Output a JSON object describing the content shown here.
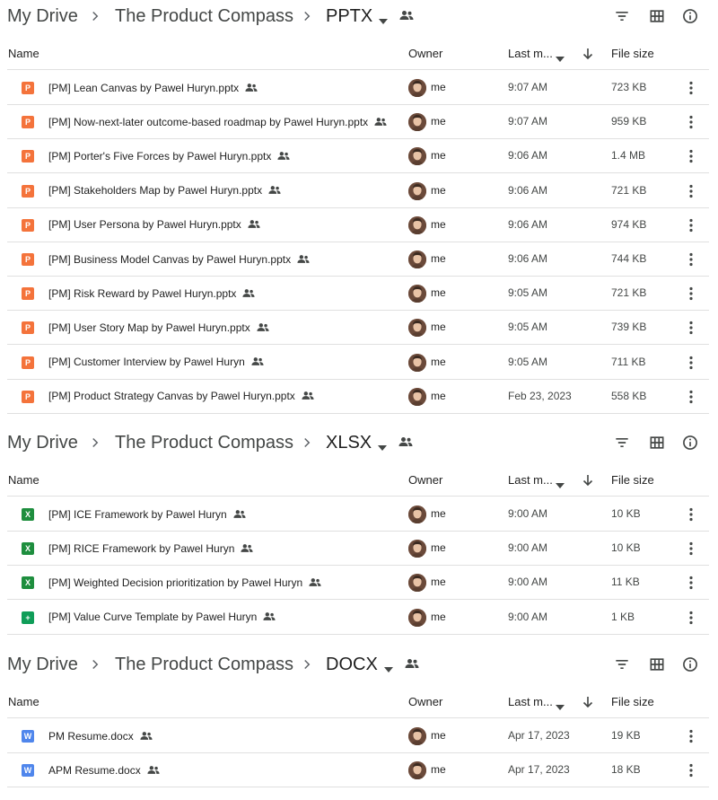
{
  "sections": [
    {
      "breadcrumb": [
        "My Drive",
        "The Product Compass",
        "PPTX"
      ],
      "headers": {
        "name": "Name",
        "owner": "Owner",
        "modified": "Last m...",
        "size": "File size"
      },
      "files": [
        {
          "type": "pptx",
          "badge": "P",
          "name": "[PM] Lean Canvas by Pawel Huryn.pptx",
          "owner": "me",
          "modified": "9:07 AM",
          "size": "723 KB"
        },
        {
          "type": "pptx",
          "badge": "P",
          "name": "[PM] Now-next-later outcome-based roadmap by Pawel Huryn.pptx",
          "owner": "me",
          "modified": "9:07 AM",
          "size": "959 KB"
        },
        {
          "type": "pptx",
          "badge": "P",
          "name": "[PM] Porter's Five Forces by Pawel Huryn.pptx",
          "owner": "me",
          "modified": "9:06 AM",
          "size": "1.4 MB"
        },
        {
          "type": "pptx",
          "badge": "P",
          "name": "[PM] Stakeholders Map by Pawel Huryn.pptx",
          "owner": "me",
          "modified": "9:06 AM",
          "size": "721 KB"
        },
        {
          "type": "pptx",
          "badge": "P",
          "name": "[PM] User Persona by Pawel Huryn.pptx",
          "owner": "me",
          "modified": "9:06 AM",
          "size": "974 KB"
        },
        {
          "type": "pptx",
          "badge": "P",
          "name": "[PM] Business Model Canvas by Pawel Huryn.pptx",
          "owner": "me",
          "modified": "9:06 AM",
          "size": "744 KB"
        },
        {
          "type": "pptx",
          "badge": "P",
          "name": "[PM] Risk Reward by Pawel Huryn.pptx",
          "owner": "me",
          "modified": "9:05 AM",
          "size": "721 KB"
        },
        {
          "type": "pptx",
          "badge": "P",
          "name": "[PM] User Story Map by Pawel Huryn.pptx",
          "owner": "me",
          "modified": "9:05 AM",
          "size": "739 KB"
        },
        {
          "type": "pptx",
          "badge": "P",
          "name": "[PM] Customer Interview by Pawel Huryn",
          "owner": "me",
          "modified": "9:05 AM",
          "size": "711 KB"
        },
        {
          "type": "pptx",
          "badge": "P",
          "name": "[PM] Product Strategy Canvas by Pawel Huryn.pptx",
          "owner": "me",
          "modified": "Feb 23, 2023",
          "size": "558 KB"
        }
      ]
    },
    {
      "breadcrumb": [
        "My Drive",
        "The Product Compass",
        "XLSX"
      ],
      "headers": {
        "name": "Name",
        "owner": "Owner",
        "modified": "Last m...",
        "size": "File size"
      },
      "files": [
        {
          "type": "xlsx",
          "badge": "X",
          "name": "[PM] ICE Framework by Pawel Huryn",
          "owner": "me",
          "modified": "9:00 AM",
          "size": "10 KB"
        },
        {
          "type": "xlsx",
          "badge": "X",
          "name": "[PM] RICE Framework by Pawel Huryn",
          "owner": "me",
          "modified": "9:00 AM",
          "size": "10 KB"
        },
        {
          "type": "xlsx",
          "badge": "X",
          "name": "[PM] Weighted Decision prioritization by Pawel Huryn",
          "owner": "me",
          "modified": "9:00 AM",
          "size": "11 KB"
        },
        {
          "type": "sheets",
          "badge": "+",
          "name": "[PM] Value Curve Template by Pawel Huryn",
          "owner": "me",
          "modified": "9:00 AM",
          "size": "1 KB"
        }
      ]
    },
    {
      "breadcrumb": [
        "My Drive",
        "The Product Compass",
        "DOCX"
      ],
      "headers": {
        "name": "Name",
        "owner": "Owner",
        "modified": "Last m...",
        "size": "File size"
      },
      "files": [
        {
          "type": "docx",
          "badge": "W",
          "name": "PM Resume.docx",
          "owner": "me",
          "modified": "Apr 17, 2023",
          "size": "19 KB"
        },
        {
          "type": "docx",
          "badge": "W",
          "name": "APM Resume.docx",
          "owner": "me",
          "modified": "Apr 17, 2023",
          "size": "18 KB"
        }
      ]
    }
  ],
  "icons": {
    "breadcrumb_separator": "chevron-right-icon",
    "folder_menu": "caret-down-icon",
    "folder_shared": "people-icon",
    "toolbar": [
      "filter-icon",
      "grid-view-icon",
      "info-icon"
    ],
    "sort_direction": "arrow-down-icon",
    "row_shared": "people-icon",
    "row_menu": "more-vert-icon"
  },
  "colors": {
    "pptx": "#f4733b",
    "xlsx": "#1e8e3e",
    "sheets": "#0f9d58",
    "docx": "#4f86ec",
    "text": "#1f1f1f",
    "secondary": "#444746",
    "divider": "#e0e0e0"
  }
}
